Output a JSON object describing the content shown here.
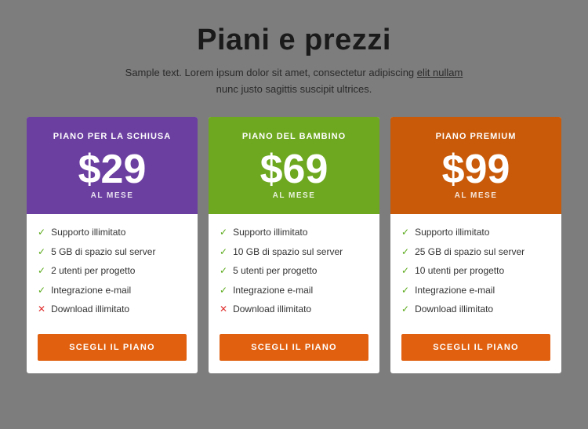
{
  "page": {
    "background": "#7d7d7d"
  },
  "header": {
    "title": "Piani e prezzi",
    "subtitle_line1": "Sample text. Lorem ipsum dolor sit amet, consectetur adipiscing",
    "subtitle_link": "elit nullam",
    "subtitle_line2": "nunc justo sagittis suscipit ultrices."
  },
  "plans": [
    {
      "id": "basic",
      "header_class": "purple",
      "name": "PIANO PER LA SCHIUSA",
      "price": "$29",
      "period": "AL MESE",
      "features": [
        {
          "text": "Supporto illimitato",
          "yes": true
        },
        {
          "text": "5 GB di spazio sul server",
          "yes": true
        },
        {
          "text": "2 utenti per progetto",
          "yes": true
        },
        {
          "text": "Integrazione e-mail",
          "yes": true
        },
        {
          "text": "Download illimitato",
          "yes": false
        }
      ],
      "cta": "SCEGLI IL PIANO"
    },
    {
      "id": "standard",
      "header_class": "green",
      "name": "PIANO DEL BAMBINO",
      "price": "$69",
      "period": "AL MESE",
      "features": [
        {
          "text": "Supporto illimitato",
          "yes": true
        },
        {
          "text": "10 GB di spazio sul server",
          "yes": true
        },
        {
          "text": "5 utenti per progetto",
          "yes": true
        },
        {
          "text": "Integrazione e-mail",
          "yes": true
        },
        {
          "text": "Download illimitato",
          "yes": false
        }
      ],
      "cta": "SCEGLI IL PIANO"
    },
    {
      "id": "premium",
      "header_class": "orange",
      "name": "PIANO PREMIUM",
      "price": "$99",
      "period": "AL MESE",
      "features": [
        {
          "text": "Supporto illimitato",
          "yes": true
        },
        {
          "text": "25 GB di spazio sul server",
          "yes": true
        },
        {
          "text": "10 utenti per progetto",
          "yes": true
        },
        {
          "text": "Integrazione e-mail",
          "yes": true
        },
        {
          "text": "Download illimitato",
          "yes": true
        }
      ],
      "cta": "SCEGLI IL PIANO"
    }
  ]
}
